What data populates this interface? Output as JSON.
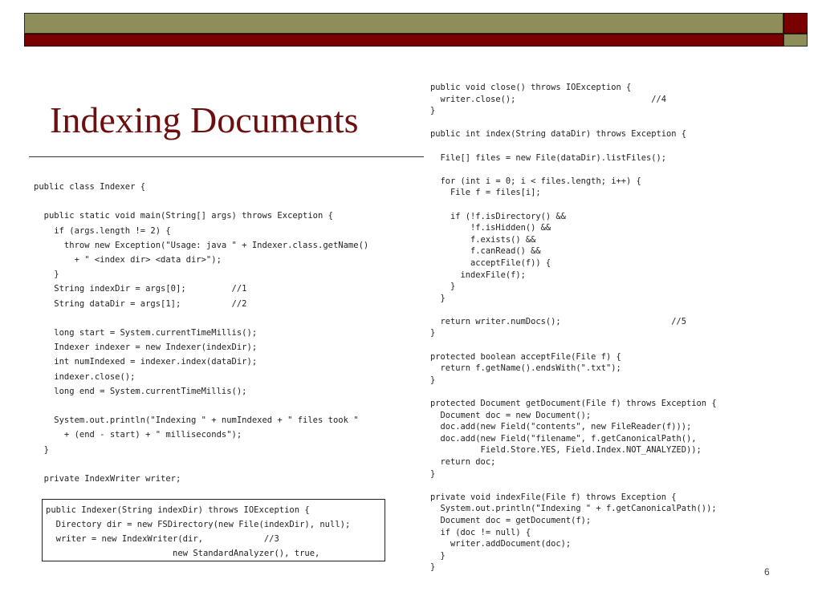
{
  "slide": {
    "title": "Indexing Documents",
    "page_number": "6"
  },
  "code_left": "public class Indexer {\n\n  public static void main(String[] args) throws Exception {\n    if (args.length != 2) {\n      throw new Exception(\"Usage: java \" + Indexer.class.getName()\n        + \" <index dir> <data dir>\");\n    }\n    String indexDir = args[0];         //1\n    String dataDir = args[1];          //2\n\n    long start = System.currentTimeMillis();\n    Indexer indexer = new Indexer(indexDir);\n    int numIndexed = indexer.index(dataDir);\n    indexer.close();\n    long end = System.currentTimeMillis();\n\n    System.out.println(\"Indexing \" + numIndexed + \" files took \"\n      + (end - start) + \" milliseconds\");\n  }\n\n  private IndexWriter writer;",
  "code_box": "public Indexer(String indexDir) throws IOException {\n  Directory dir = new FSDirectory(new File(indexDir), null);\n  writer = new IndexWriter(dir,            //3\n                         new StandardAnalyzer(), true,",
  "code_right": "public void close() throws IOException {\n  writer.close();                           //4\n}\n\npublic int index(String dataDir) throws Exception {\n\n  File[] files = new File(dataDir).listFiles();\n\n  for (int i = 0; i < files.length; i++) {\n    File f = files[i];\n\n    if (!f.isDirectory() &&\n        !f.isHidden() &&\n        f.exists() &&\n        f.canRead() &&\n        acceptFile(f)) {\n      indexFile(f);\n    }\n  }\n\n  return writer.numDocs();                      //5\n}\n\nprotected boolean acceptFile(File f) {\n  return f.getName().endsWith(\".txt\");\n}\n\nprotected Document getDocument(File f) throws Exception {\n  Document doc = new Document();\n  doc.add(new Field(\"contents\", new FileReader(f)));\n  doc.add(new Field(\"filename\", f.getCanonicalPath(),\n          Field.Store.YES, Field.Index.NOT_ANALYZED));\n  return doc;\n}\n\nprivate void indexFile(File f) throws Exception {\n  System.out.println(\"Indexing \" + f.getCanonicalPath());\n  Document doc = getDocument(f);\n  if (doc != null) {\n    writer.addDocument(doc);\n  }\n}",
  "colors": {
    "title": "#6b0f0f",
    "band_olive": "#8e8e5a",
    "band_maroon": "#7a0000"
  }
}
